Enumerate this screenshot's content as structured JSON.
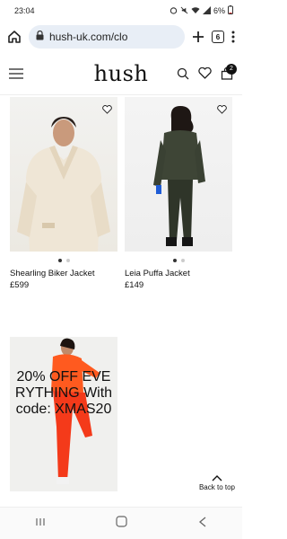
{
  "status": {
    "time": "23:04",
    "battery": "6%"
  },
  "browser": {
    "url": "hush-uk.com/clo",
    "tab_count": "6"
  },
  "site": {
    "logo": "hush",
    "bag_count": "2"
  },
  "products": [
    {
      "name": "Shearling Biker Jacket",
      "price": "£599",
      "image": "cream shearling biker jacket on model"
    },
    {
      "name": "Leia Puffa Jacket",
      "price": "£149",
      "image": "khaki puffer jacket on model"
    }
  ],
  "promo": {
    "text": "20% OFF EVERYTHING With code: XMAS20"
  },
  "back_to_top": "Back to top",
  "icons": [
    "home-icon",
    "lock-icon",
    "plus-icon",
    "tab-switcher-icon",
    "more-icon",
    "menu-icon",
    "search-icon",
    "heart-icon",
    "bag-icon",
    "chevron-up-icon"
  ]
}
